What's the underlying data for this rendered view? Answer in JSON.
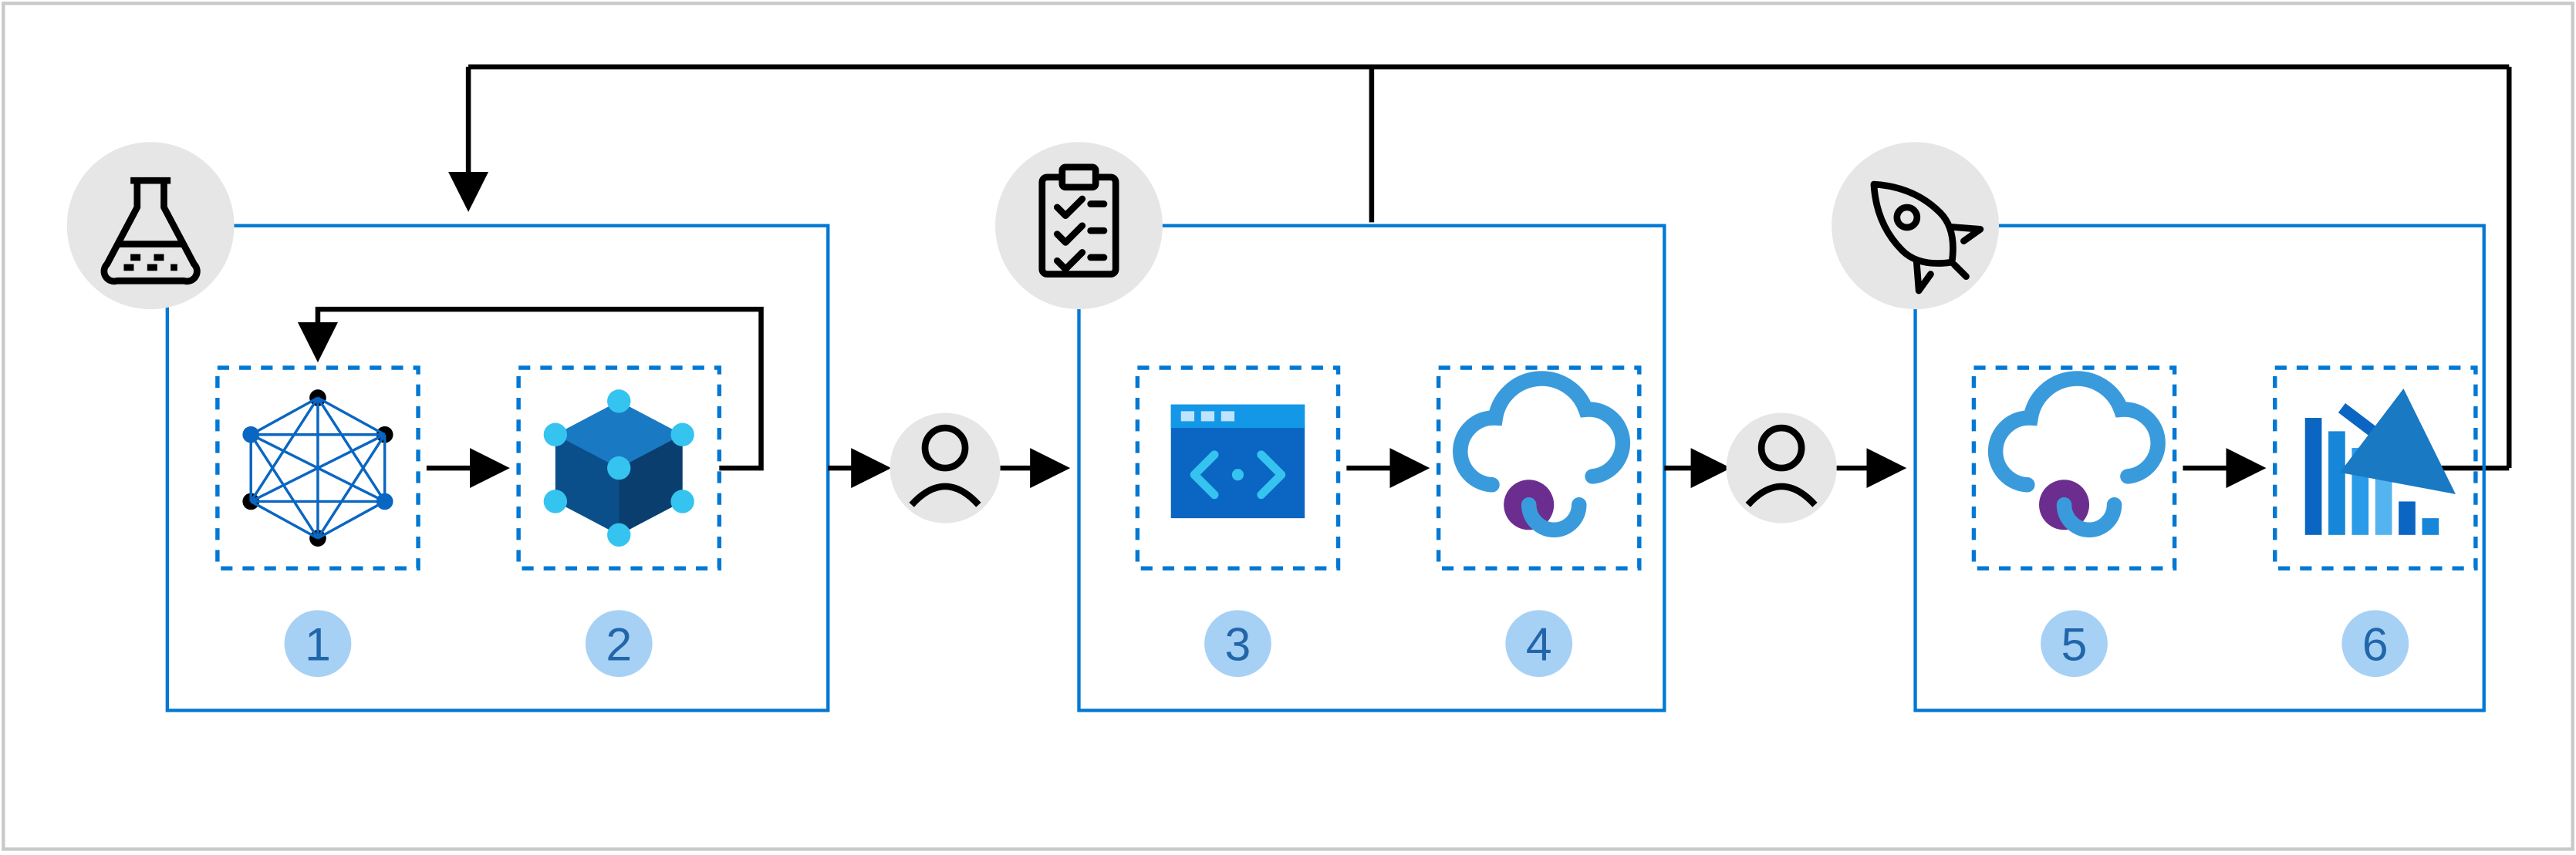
{
  "diagram": {
    "stages": [
      {
        "id": "experiment",
        "icon": "flask-icon",
        "steps": [
          {
            "num": "1",
            "icon": "neural-network-icon"
          },
          {
            "num": "2",
            "icon": "model-package-icon"
          }
        ]
      },
      {
        "id": "validate",
        "icon": "clipboard-check-icon",
        "steps": [
          {
            "num": "3",
            "icon": "code-window-icon"
          },
          {
            "num": "4",
            "icon": "cloud-deploy-icon"
          }
        ]
      },
      {
        "id": "launch",
        "icon": "rocket-icon",
        "steps": [
          {
            "num": "5",
            "icon": "cloud-deploy-icon"
          },
          {
            "num": "6",
            "icon": "monitoring-chart-icon"
          }
        ]
      }
    ],
    "gates": [
      "approval-gate-1",
      "approval-gate-2"
    ],
    "feedback_arrows": [
      {
        "from": "stage-3-step-6",
        "to": "top-bus"
      },
      {
        "from": "stage-2-top",
        "to": "top-bus"
      },
      {
        "from": "top-bus",
        "to": "stage-1-top"
      }
    ],
    "internal_feedback": {
      "from": "step-2",
      "to": "step-1"
    }
  }
}
